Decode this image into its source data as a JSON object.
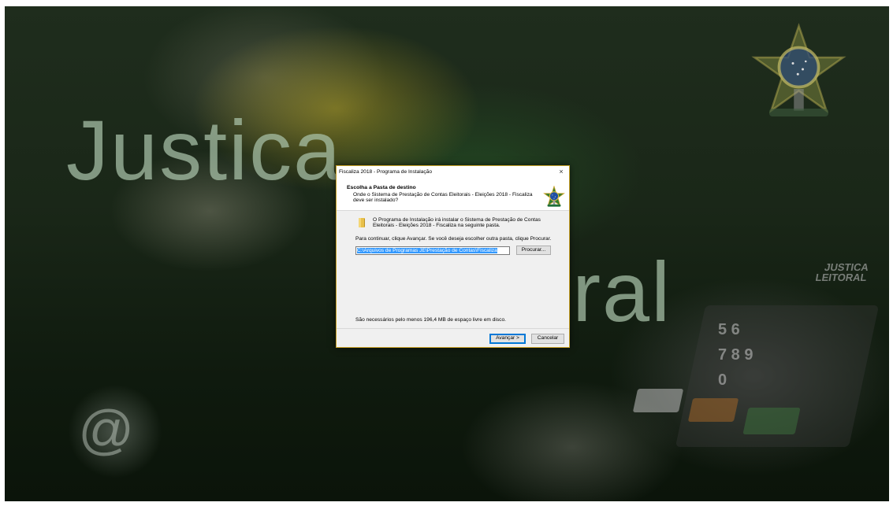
{
  "background": {
    "word_line1": "Justica",
    "word_line2": "itoral",
    "stamp_text": "JUSTICA\nLEITORAL",
    "keypad_keys": "5 6\n7 8 9\n0",
    "at_symbol": "@"
  },
  "dialog": {
    "title": "Fiscaliza 2018 - Programa de Instalação",
    "close_icon": "×",
    "header_title": "Escolha a Pasta de destino",
    "header_subtitle": "Onde o Sistema de Prestação de Contas Eleitorais - Eleições 2018 - Fiscaliza deve ser instalado?",
    "info_text": "O Programa de Instalação irá instalar o Sistema de Prestação de Contas Eleitorais - Eleições 2018 - Fiscaliza na seguinte pasta.",
    "continue_text": "Para continuar, clique Avançar. Se você deseja escolher outra pasta, clique Procurar.",
    "path_value": "C:\\Arquivos de Programas JE\\Prestação de Contas\\Fiscaliza",
    "browse_label": "Procurar...",
    "space_text": "São necessários pelo menos 196,4 MB de espaço livre em disco.",
    "next_label": "Avançar >",
    "cancel_label": "Cancelar"
  },
  "icons": {
    "folder": "folder-icon",
    "emblem": "brazil-coat-of-arms-icon"
  },
  "colors": {
    "selection": "#3399ff",
    "default_button_border": "#0078d7",
    "dialog_border": "#c9a227"
  }
}
